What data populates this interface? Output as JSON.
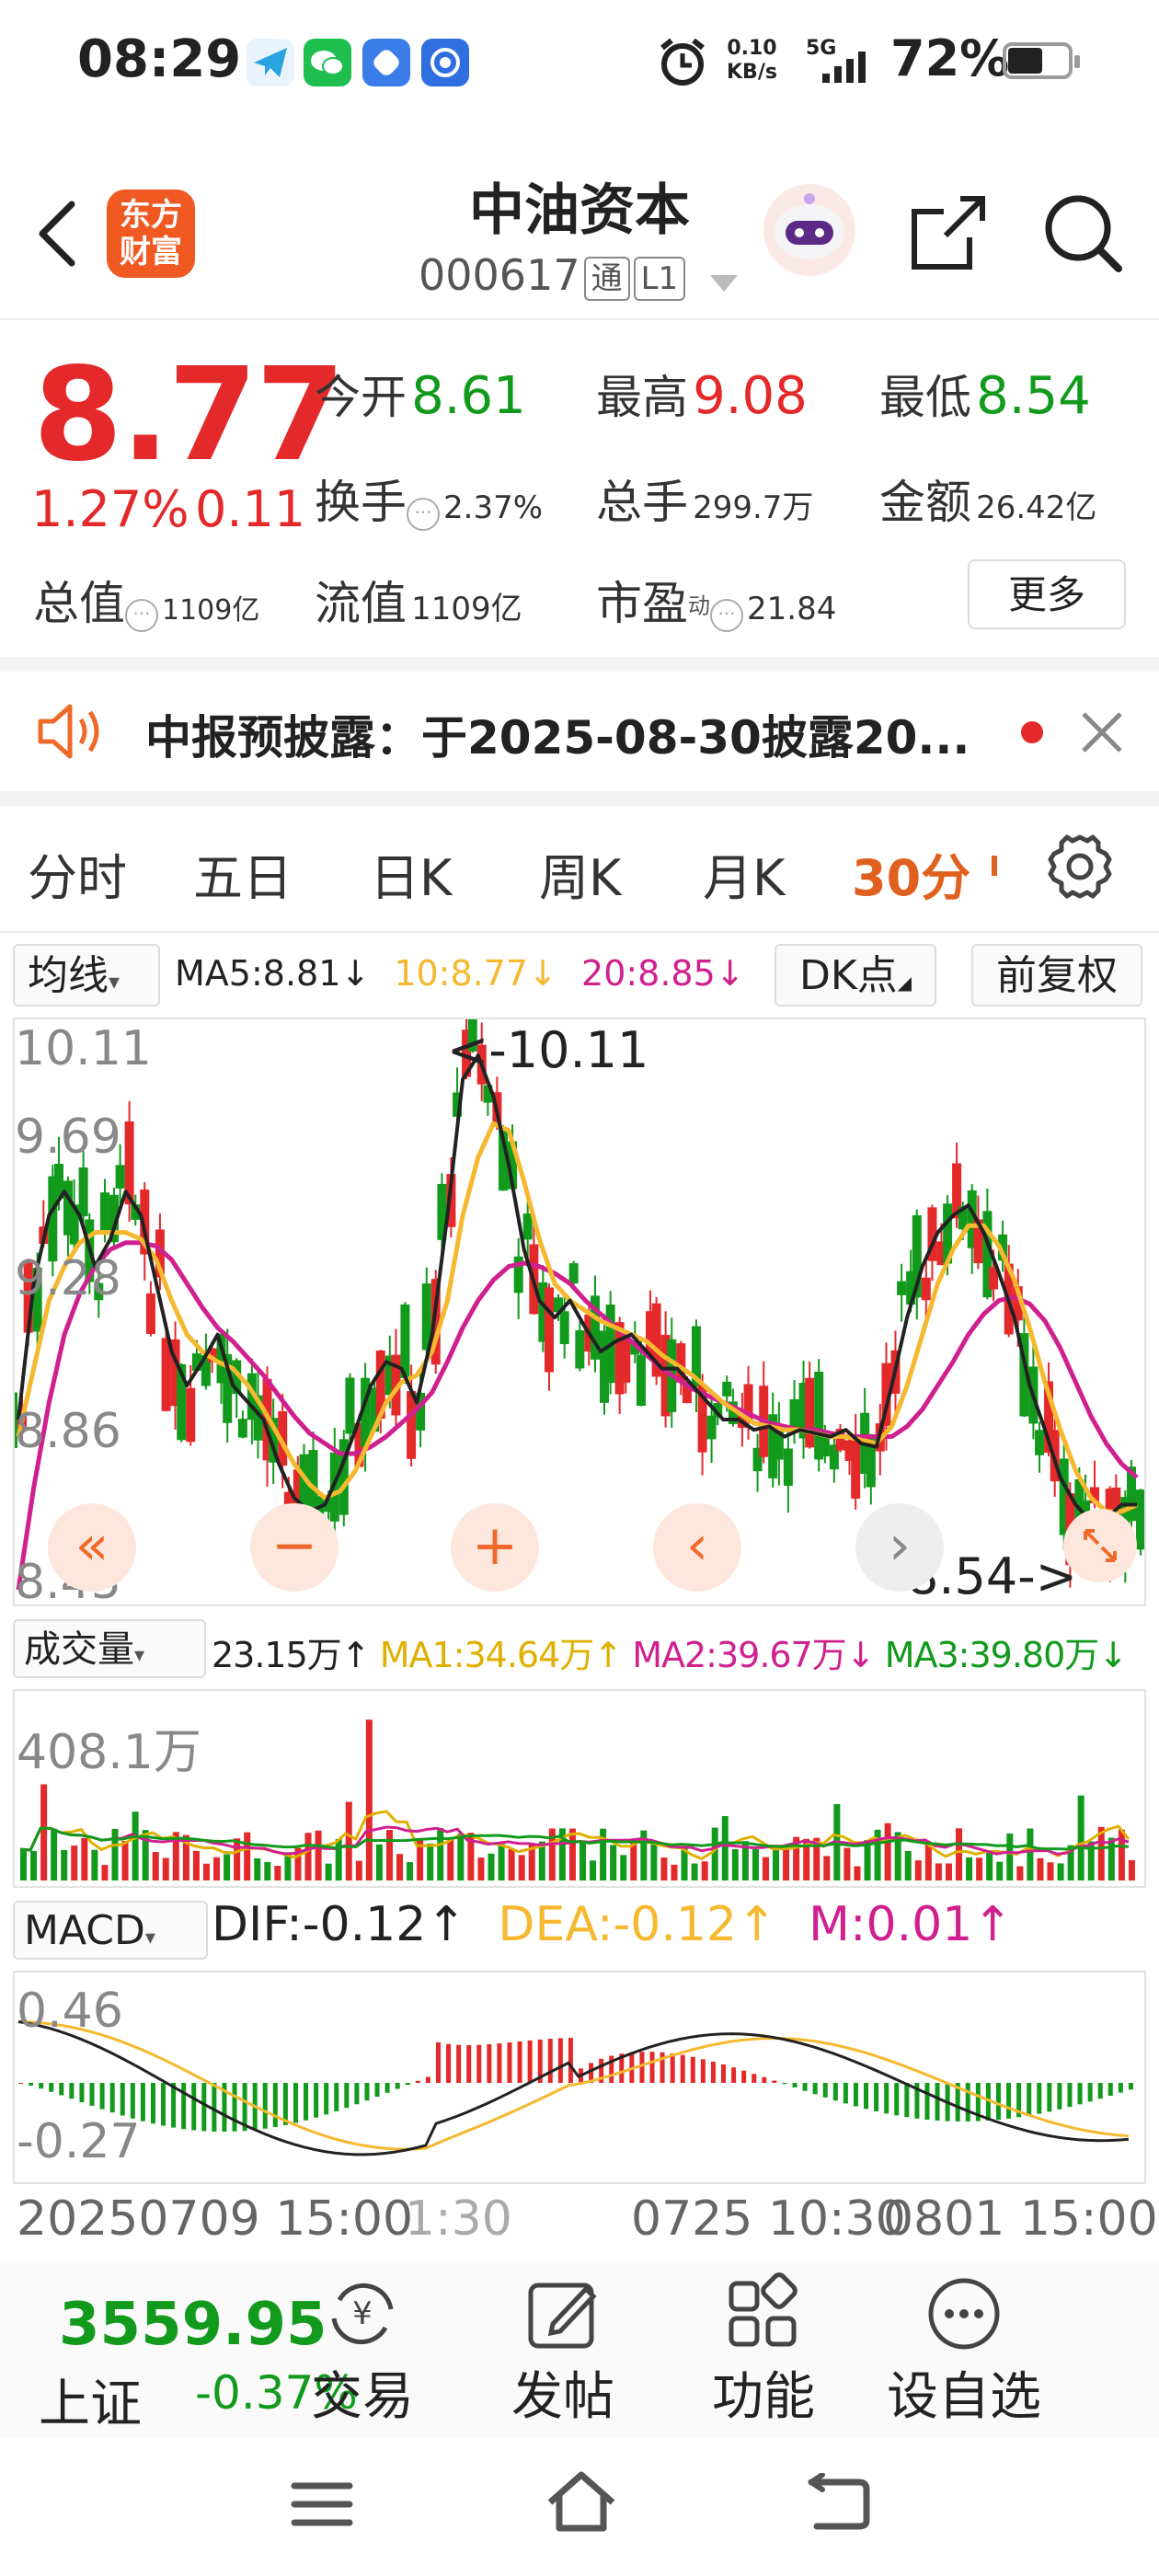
{
  "status_bar": {
    "time": "08:29",
    "net_speed_value": "0.10",
    "net_speed_unit": "KB/s",
    "signal": "5G",
    "battery": "72%",
    "battery_level": 0.62
  },
  "header": {
    "logo_text_1": "东方",
    "logo_text_2": "财富",
    "stock_name": "中油资本",
    "stock_code": "000617",
    "tag_tong": "通",
    "tag_level": "L1"
  },
  "quote": {
    "price": "8.77",
    "change_pct": "1.27%",
    "change": "0.11",
    "open_label": "今开",
    "open": "8.61",
    "high_label": "最高",
    "high": "9.08",
    "low_label": "最低",
    "low": "8.54",
    "turnover_label": "换手",
    "turnover": "2.37%",
    "volume_label": "总手",
    "volume": "299.7万",
    "amount_label": "金额",
    "amount": "26.42亿",
    "mktcap_label": "总值",
    "mktcap": "1109亿",
    "float_label": "流值",
    "float": "1109亿",
    "pe_label": "市盈",
    "pe_sup": "动",
    "pe": "21.84",
    "more_label": "更多"
  },
  "notice": {
    "text": "中报预披露：于2025-08-30披露20..."
  },
  "tabs": [
    {
      "label": "分时"
    },
    {
      "label": "五日"
    },
    {
      "label": "日K"
    },
    {
      "label": "周K"
    },
    {
      "label": "月K"
    },
    {
      "label": "30分"
    }
  ],
  "chart_controls": {
    "ma_select": "均线",
    "ma5": "MA5:8.81↓",
    "ma10": "10:8.77↓",
    "ma20": "20:8.85↓",
    "dk_label": "DK点",
    "adjust_label": "前复权"
  },
  "colors": {
    "up": "#e4292b",
    "down": "#119a1c",
    "ma5": "#222222",
    "ma10": "#f5b82e",
    "ma20": "#d0208f",
    "accent": "#e0611f"
  },
  "chart_data": {
    "type": "candlestick",
    "y_ticks": [
      "10.11",
      "9.69",
      "9.28",
      "8.86",
      "8.45"
    ],
    "ylim": [
      8.45,
      10.11
    ],
    "max_label": "<-10.11",
    "min_label": "8.54->",
    "ma5": [
      8.95,
      9.35,
      9.55,
      9.62,
      9.55,
      9.4,
      9.48,
      9.62,
      9.55,
      9.35,
      9.15,
      9.05,
      9.12,
      9.2,
      9.05,
      9.0,
      8.95,
      8.82,
      8.72,
      8.68,
      8.7,
      8.8,
      8.92,
      9.05,
      9.12,
      9.1,
      9.0,
      9.2,
      9.55,
      9.95,
      10.02,
      9.9,
      9.7,
      9.45,
      9.3,
      9.25,
      9.3,
      9.22,
      9.15,
      9.18,
      9.2,
      9.15,
      9.1,
      9.1,
      9.05,
      9.0,
      8.95,
      8.95,
      8.92,
      8.93,
      8.9,
      8.92,
      8.91,
      8.9,
      8.92,
      8.88,
      8.87,
      9.05,
      9.25,
      9.4,
      9.5,
      9.55,
      9.58,
      9.5,
      9.38,
      9.25,
      9.05,
      8.92,
      8.78,
      8.7,
      8.65,
      8.66,
      8.7,
      8.7
    ],
    "ma10": [
      8.9,
      9.1,
      9.3,
      9.4,
      9.47,
      9.5,
      9.5,
      9.5,
      9.48,
      9.42,
      9.3,
      9.2,
      9.15,
      9.12,
      9.1,
      9.05,
      8.98,
      8.9,
      8.82,
      8.76,
      8.72,
      8.74,
      8.8,
      8.9,
      9.0,
      9.06,
      9.08,
      9.15,
      9.3,
      9.55,
      9.72,
      9.82,
      9.8,
      9.65,
      9.48,
      9.35,
      9.3,
      9.27,
      9.24,
      9.22,
      9.2,
      9.18,
      9.14,
      9.11,
      9.08,
      9.04,
      9.0,
      8.97,
      8.94,
      8.93,
      8.92,
      8.92,
      8.91,
      8.9,
      8.9,
      8.89,
      8.88,
      8.93,
      9.05,
      9.2,
      9.35,
      9.45,
      9.52,
      9.52,
      9.46,
      9.36,
      9.22,
      9.06,
      8.92,
      8.8,
      8.72,
      8.68,
      8.68,
      8.7
    ],
    "ma20": [
      8.45,
      8.75,
      9.0,
      9.2,
      9.32,
      9.4,
      9.45,
      9.47,
      9.47,
      9.46,
      9.42,
      9.35,
      9.28,
      9.22,
      9.18,
      9.13,
      9.08,
      9.02,
      8.96,
      8.91,
      8.88,
      8.85,
      8.85,
      8.87,
      8.9,
      8.94,
      8.98,
      9.03,
      9.12,
      9.22,
      9.3,
      9.36,
      9.4,
      9.41,
      9.4,
      9.38,
      9.35,
      9.3,
      9.26,
      9.22,
      9.18,
      9.14,
      9.1,
      9.07,
      9.04,
      9.02,
      9.0,
      8.98,
      8.96,
      8.94,
      8.93,
      8.92,
      8.92,
      8.91,
      8.9,
      8.9,
      8.9,
      8.9,
      8.93,
      8.98,
      9.05,
      9.12,
      9.2,
      9.26,
      9.3,
      9.31,
      9.29,
      9.24,
      9.16,
      9.06,
      8.96,
      8.88,
      8.82,
      8.78
    ],
    "volume": {
      "label": "成交量",
      "value": "23.15万↑",
      "ma1": "MA1:34.64万↑",
      "ma2": "MA2:39.67万↓",
      "ma3": "MA3:39.80万↓",
      "max_tick": "408.1万"
    },
    "macd": {
      "label": "MACD",
      "dif": "DIF:-0.12↑",
      "dea": "DEA:-0.12↑",
      "m": "M:0.01↑",
      "ticks": [
        "0.46",
        "-0.27"
      ]
    },
    "x_ticks": [
      "20250709 15:00",
      "1:30",
      "0725 10:30",
      "0801 15:00"
    ]
  },
  "bottom_bar": {
    "index_value": "3559.95",
    "index_name": "上证",
    "index_change": "-0.37%",
    "items": [
      {
        "label": "交易",
        "icon": "yen-cycle-icon"
      },
      {
        "label": "发帖",
        "icon": "edit-icon"
      },
      {
        "label": "功能",
        "icon": "grid-icon"
      },
      {
        "label": "设自选",
        "icon": "more-circle-icon"
      }
    ]
  }
}
